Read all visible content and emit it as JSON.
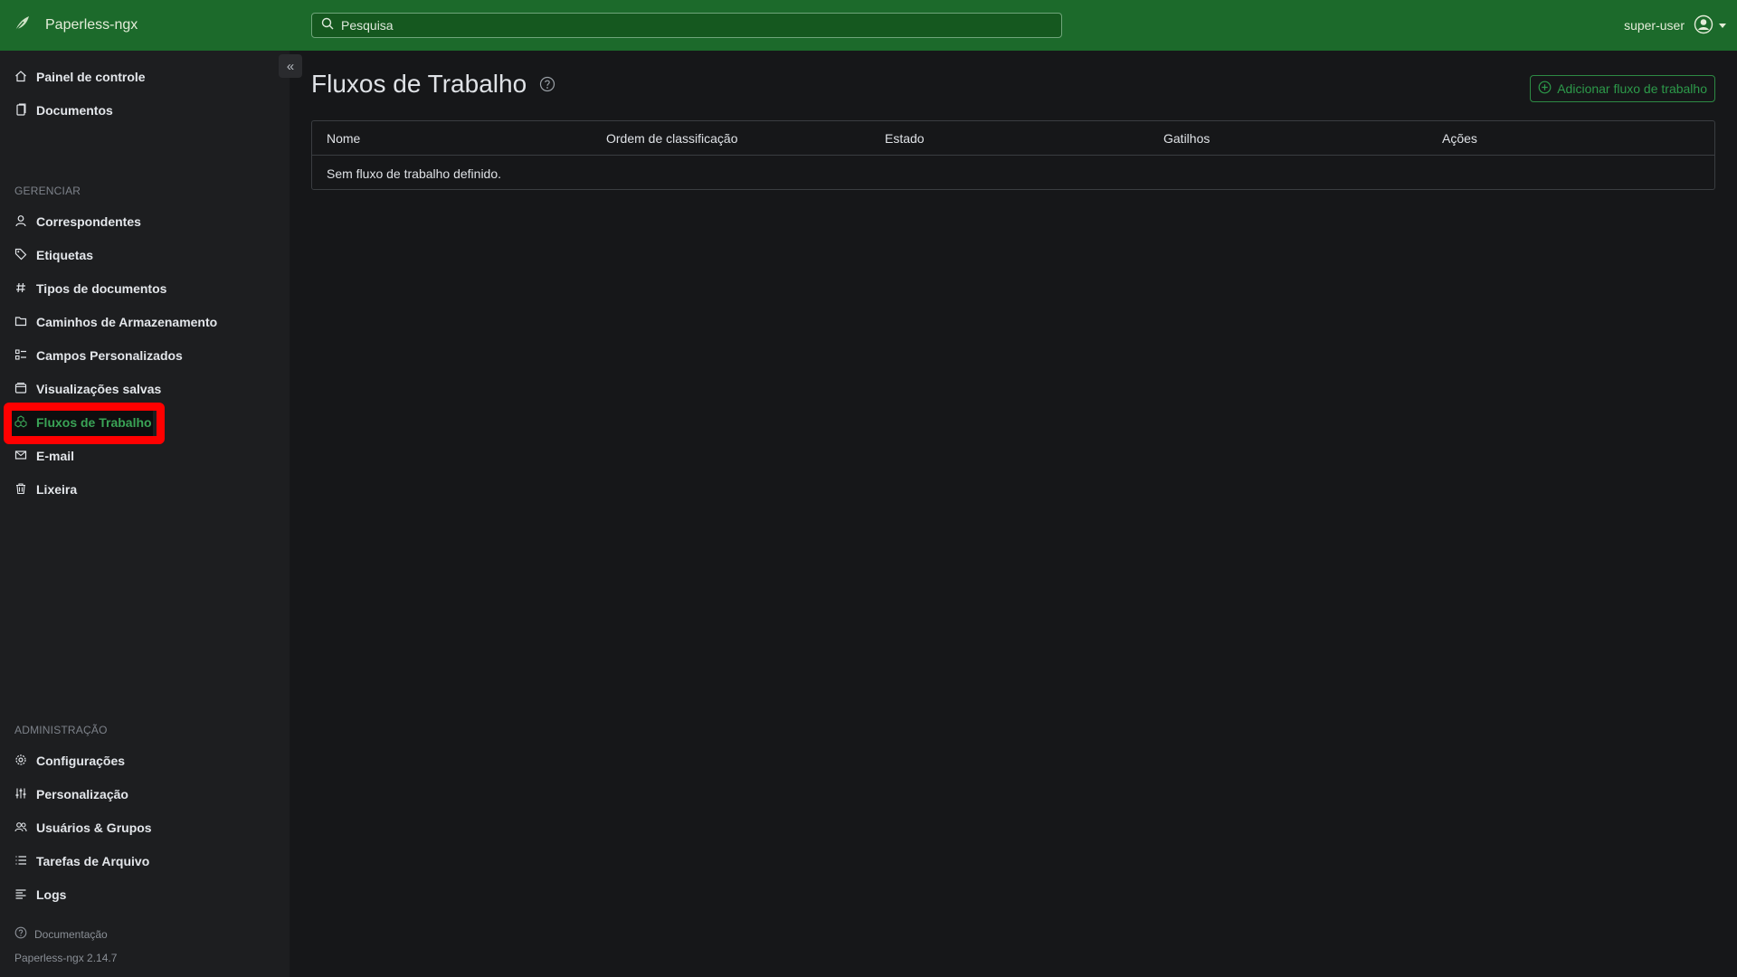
{
  "app": {
    "name": "Paperless-ngx"
  },
  "search": {
    "placeholder": "Pesquisa"
  },
  "user": {
    "name": "super-user"
  },
  "sidebar": {
    "top_items": [
      {
        "label": "Painel de controle"
      },
      {
        "label": "Documentos"
      }
    ],
    "manage_label": "GERENCIAR",
    "manage_items": [
      {
        "label": "Correspondentes"
      },
      {
        "label": "Etiquetas"
      },
      {
        "label": "Tipos de documentos"
      },
      {
        "label": "Caminhos de Armazenamento"
      },
      {
        "label": "Campos Personalizados"
      },
      {
        "label": "Visualizações salvas"
      },
      {
        "label": "Fluxos de Trabalho",
        "active": true
      },
      {
        "label": "E-mail"
      },
      {
        "label": "Lixeira"
      }
    ],
    "admin_label": "ADMINISTRAÇÃO",
    "admin_items": [
      {
        "label": "Configurações"
      },
      {
        "label": "Personalização"
      },
      {
        "label": "Usuários & Grupos"
      },
      {
        "label": "Tarefas de Arquivo"
      },
      {
        "label": "Logs"
      }
    ],
    "docs_link": "Documentação",
    "version": "Paperless-ngx 2.14.7"
  },
  "main": {
    "title": "Fluxos de Trabalho",
    "add_button": "Adicionar fluxo de trabalho",
    "table": {
      "columns": [
        "Nome",
        "Ordem de classificação",
        "Estado",
        "Gatilhos",
        "Ações"
      ],
      "empty_message": "Sem fluxo de trabalho definido."
    }
  },
  "colors": {
    "navbar": "#1c6a2b",
    "accent": "#2d9a4a",
    "highlight_box": "#ff0000"
  }
}
